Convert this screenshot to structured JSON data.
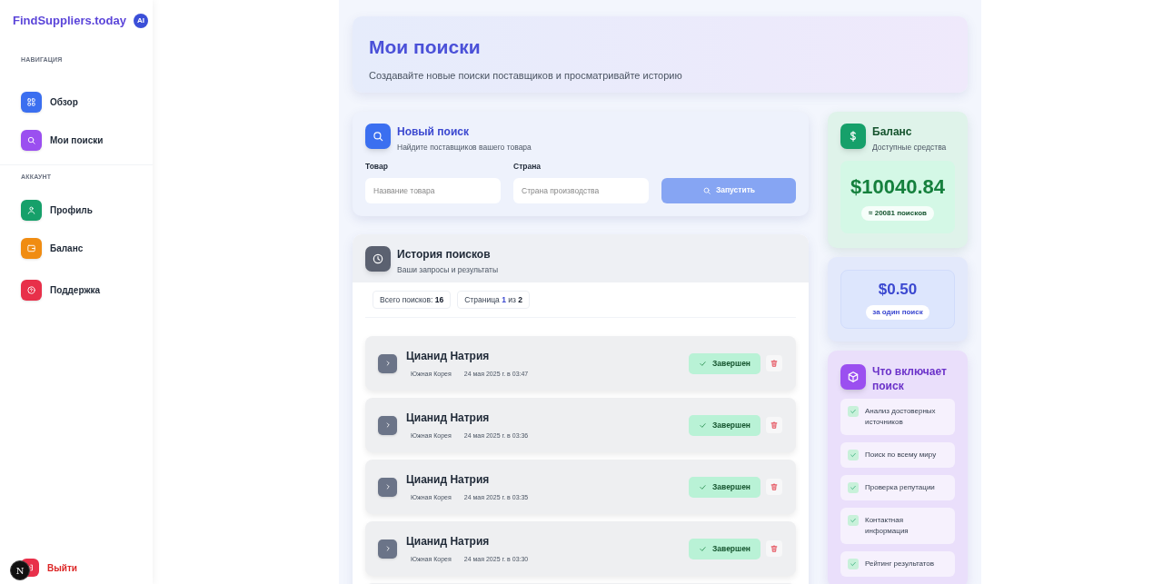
{
  "sidebar": {
    "brand": "FindSuppliers.today",
    "brand_badge": "AI",
    "sections": [
      {
        "title": "НАВИГАЦИЯ",
        "items": [
          {
            "label": "Обзор",
            "color": "#3b6ff0"
          },
          {
            "label": "Мои поиски",
            "color": "#9b4ff0"
          }
        ]
      },
      {
        "title": "АККАУНТ",
        "items": [
          {
            "label": "Профиль",
            "color": "#16a06a"
          },
          {
            "label": "Баланс",
            "color": "#f08c12"
          },
          {
            "label": "Поддержка",
            "color": "#e8304a"
          }
        ]
      }
    ],
    "logout": "Выйти",
    "dev_badge": "N"
  },
  "header": {
    "title": "Мои поиски",
    "subtitle": "Создавайте новые поиски поставщиков и просматривайте историю"
  },
  "new_search": {
    "title": "Новый поиск",
    "subtitle": "Найдите поставщиков вашего товара",
    "fields": [
      {
        "label": "Товар",
        "placeholder": "Название товара"
      },
      {
        "label": "Страна",
        "placeholder": "Страна производства"
      }
    ],
    "button": "Запустить",
    "button_disabled": true
  },
  "history": {
    "title": "История поисков",
    "subtitle": "Ваши запросы и результаты",
    "stats": [
      {
        "label": "Всего поисков: ",
        "value": "16"
      },
      {
        "label": "Страница ",
        "value": "1",
        "sep": " из ",
        "total": "2"
      }
    ],
    "rows": [
      {
        "product": "Цианид Натрия",
        "country": "Южная Корея",
        "date": "24 мая 2025 г. в 03:47",
        "status": "Завершен",
        "kind": "done"
      },
      {
        "product": "Цианид Натрия",
        "country": "Южная Корея",
        "date": "24 мая 2025 г. в 03:36",
        "status": "Завершен",
        "kind": "done"
      },
      {
        "product": "Цианид Натрия",
        "country": "Южная Корея",
        "date": "24 мая 2025 г. в 03:35",
        "status": "Завершен",
        "kind": "done"
      },
      {
        "product": "Цианид Натрия",
        "country": "Южная Корея",
        "date": "24 мая 2025 г. в 03:30",
        "status": "Завершен",
        "kind": "done"
      }
    ]
  },
  "balance": {
    "title": "Баланс",
    "subtitle": "Доступные средства",
    "amount": "$10040.84",
    "searches": "≈ 20081 поисков"
  },
  "price": {
    "amount": "$0.50",
    "caption": "за один поиск"
  },
  "includes": {
    "title": "Что включает поиск",
    "items": [
      "Анализ достоверных источников",
      "Поиск по всему миру",
      "Проверка репутации",
      "Контактная информация",
      "Рейтинг результатов"
    ]
  }
}
